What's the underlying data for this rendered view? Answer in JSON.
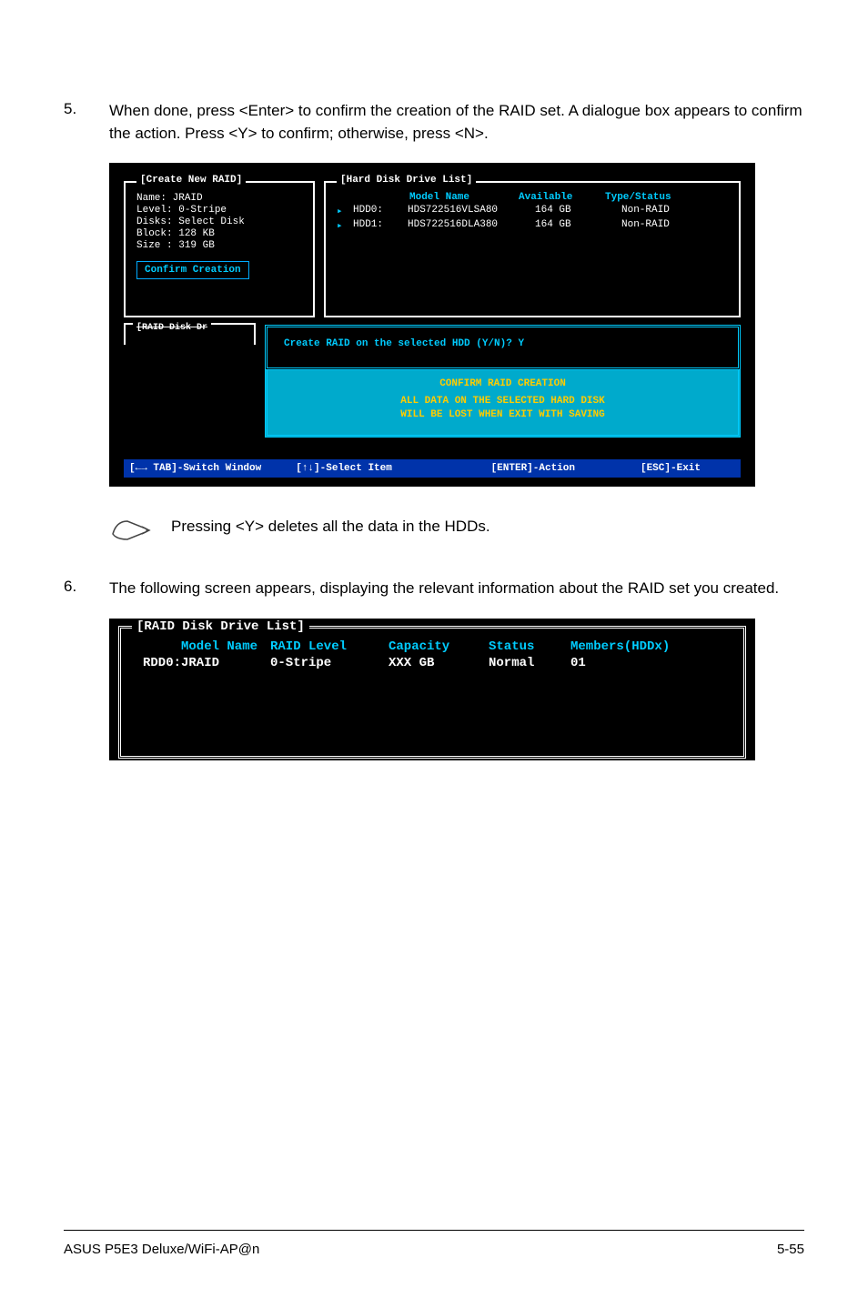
{
  "step5": {
    "num": "5.",
    "text": "When done, press <Enter> to confirm the creation of the RAID set. A dialogue box appears to confirm the action. Press <Y> to confirm; otherwise, press <N>."
  },
  "bios1": {
    "create": {
      "title": "[Create New RAID]",
      "rows": {
        "name_l": "Name:",
        "name_v": "JRAID",
        "level_l": "Level:",
        "level_v": "0-Stripe",
        "disks_l": "Disks:",
        "disks_v": "Select Disk",
        "block_l": "Block:",
        "block_v": "128 KB",
        "size_l": "Size :",
        "size_v": "319 GB"
      },
      "confirm": "Confirm Creation"
    },
    "hdd": {
      "title": "[Hard Disk Drive List]",
      "headers": {
        "model": "Model Name",
        "avail": "Available",
        "type": "Type/Status"
      },
      "rows": [
        {
          "slot": "HDD0:",
          "model": "HDS722516VLSA80",
          "avail": "164 GB",
          "type": "Non-RAID"
        },
        {
          "slot": "HDD1:",
          "model": "HDS722516DLA380",
          "avail": "164 GB",
          "type": "Non-RAID"
        }
      ]
    },
    "raid_stub": "[RAID Disk Dr",
    "prompt": "Create RAID on the selected HDD (Y/N)? Y",
    "cyan": {
      "head": "CONFIRM RAID CREATION",
      "warn1": "ALL DATA ON THE SELECTED HARD DISK",
      "warn2": "WILL BE LOST WHEN EXIT WITH SAVING"
    },
    "footer": {
      "tab": "[←→ TAB]-Switch Window",
      "select": "[↑↓]-Select Item",
      "enter": "[ENTER]-Action",
      "esc": "[ESC]-Exit"
    }
  },
  "note": {
    "text": "Pressing <Y> deletes all the data in the HDDs."
  },
  "step6": {
    "num": "6.",
    "text": "The following screen appears, displaying the relevant information about the RAID set you created."
  },
  "bios2": {
    "title": "[RAID Disk Drive List]",
    "headers": {
      "model": "Model Name",
      "level": "RAID Level",
      "cap": "Capacity",
      "status": "Status",
      "members": "Members(HDDx)"
    },
    "row": {
      "model": "RDD0:JRAID",
      "level": "0-Stripe",
      "cap": "XXX GB",
      "status": "Normal",
      "members": "01"
    }
  },
  "footer": {
    "left": "ASUS P5E3 Deluxe/WiFi-AP@n",
    "right": "5-55"
  }
}
